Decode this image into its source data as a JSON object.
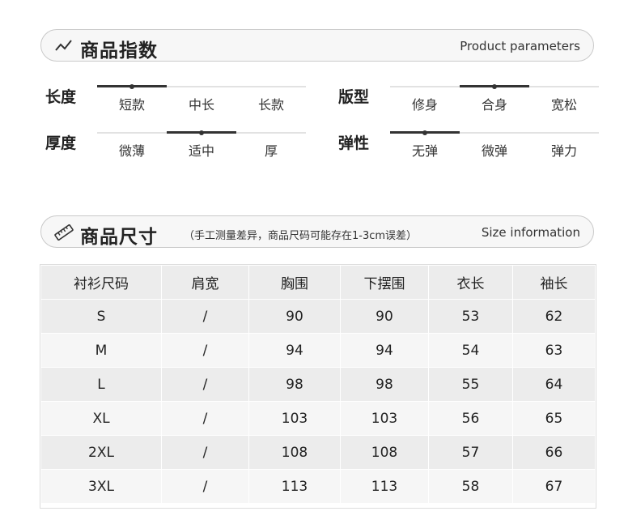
{
  "section1": {
    "title": "商品指数",
    "title_en": "Product parameters",
    "icon": "trend-line-icon"
  },
  "params": [
    {
      "label": "长度",
      "options": [
        "短款",
        "中长",
        "长款"
      ],
      "selected": 0
    },
    {
      "label": "版型",
      "options": [
        "修身",
        "合身",
        "宽松"
      ],
      "selected": 1
    },
    {
      "label": "厚度",
      "options": [
        "微薄",
        "适中",
        "厚"
      ],
      "selected": 1
    },
    {
      "label": "弹性",
      "options": [
        "无弹",
        "微弹",
        "弹力"
      ],
      "selected": 0
    }
  ],
  "section2": {
    "title": "商品尺寸",
    "note": "（手工测量差异，商品尺码可能存在1-3cm误差）",
    "title_en": "Size information",
    "icon": "ruler-icon"
  },
  "size_table": {
    "headers": [
      "衬衫尺码",
      "肩宽",
      "胸围",
      "下摆围",
      "衣长",
      "袖长"
    ],
    "rows": [
      [
        "S",
        "/",
        "90",
        "90",
        "53",
        "62"
      ],
      [
        "M",
        "/",
        "94",
        "94",
        "54",
        "63"
      ],
      [
        "L",
        "/",
        "98",
        "98",
        "55",
        "64"
      ],
      [
        "XL",
        "/",
        "103",
        "103",
        "56",
        "65"
      ],
      [
        "2XL",
        "/",
        "108",
        "108",
        "57",
        "66"
      ],
      [
        "3XL",
        "/",
        "113",
        "113",
        "58",
        "67"
      ]
    ]
  }
}
